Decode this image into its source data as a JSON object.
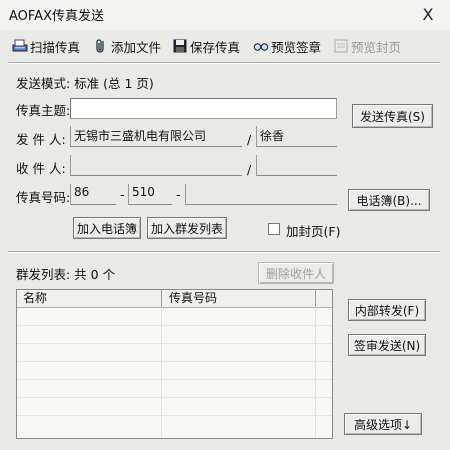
{
  "window": {
    "title": "AOFAX传真发送",
    "close_glyph": "X"
  },
  "toolbar": {
    "scan": "扫描传真",
    "add_file": "添加文件",
    "save_fax": "保存传真",
    "preview_sign": "预览签章",
    "preview_cover": "预览封页"
  },
  "form": {
    "send_mode": "发送模式: 标准 (总 1 页)",
    "subject_label": "传真主题:",
    "subject_value": "",
    "sender_label": "发 件 人:",
    "sender_company": "无锡市三盛机电有限公司",
    "sender_slash": "/",
    "sender_name": "徐香",
    "recipient_label": "收 件 人:",
    "recipient_company": "",
    "recipient_slash": "/",
    "recipient_name": "",
    "fax_label": "传真号码:",
    "fax_country": "86",
    "fax_dash1": "-",
    "fax_area": "510",
    "fax_dash2": "-",
    "fax_number": ""
  },
  "buttons": {
    "send_fax": "发送传真(S)",
    "phonebook": "电话簿(B)...",
    "add_phonebook": "加入电话簿",
    "add_group_list": "加入群发列表",
    "add_cover": "加封页(F)",
    "delete_recipient": "删除收件人",
    "internal_forward": "内部转发(F)",
    "sign_send": "签审发送(N)",
    "advanced": "高级选项↓"
  },
  "group": {
    "label": "群发列表: 共 0 个",
    "columns": [
      "名称",
      "传真号码"
    ]
  }
}
